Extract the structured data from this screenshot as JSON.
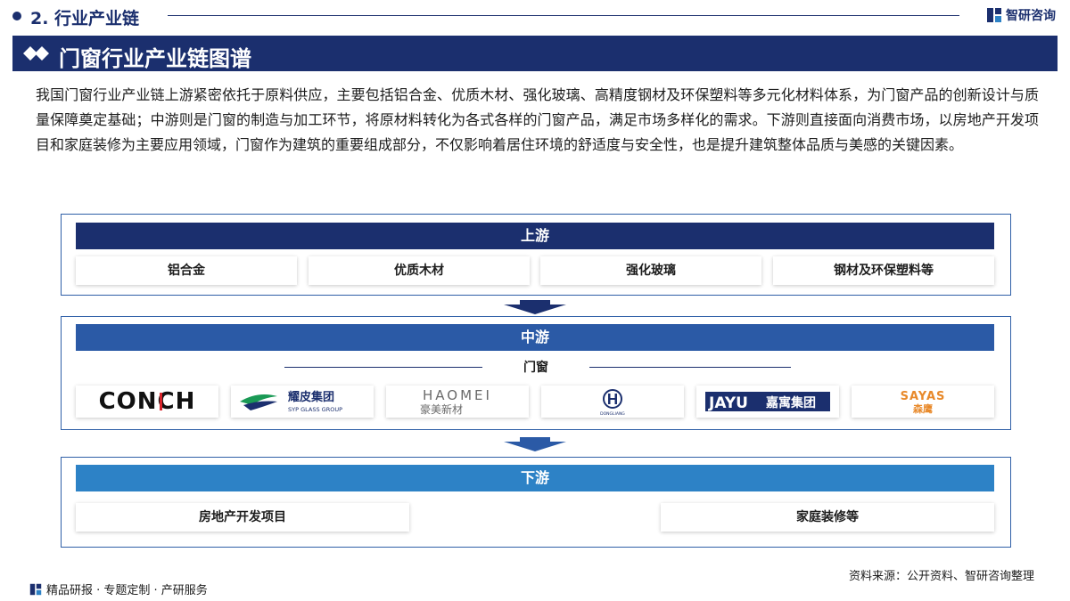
{
  "header": {
    "section_title": "2. 行业产业链",
    "brand_name": "智研咨询"
  },
  "banner": {
    "title": "门窗行业产业链图谱"
  },
  "intro": "我国门窗行业产业链上游紧密依托于原料供应，主要包括铝合金、优质木材、强化玻璃、高精度钢材及环保塑料等多元化材料体系，为门窗产品的创新设计与质量保障奠定基础；中游则是门窗的制造与加工环节，将原材料转化为各式各样的门窗产品，满足市场多样化的需求。下游则直接面向消费市场，以房地产开发项目和家庭装修为主要应用领域，门窗作为建筑的重要组成部分，不仅影响着居住环境的舒适度与安全性，也是提升建筑整体品质与美感的关键因素。",
  "upstream": {
    "title": "上游",
    "items": [
      "铝合金",
      "优质木材",
      "强化玻璃",
      "钢材及环保塑料等"
    ]
  },
  "midstream": {
    "title": "中游",
    "label": "门窗",
    "logos": [
      {
        "name": "conch",
        "text": "CONCH"
      },
      {
        "name": "syp",
        "text": "耀皮集团",
        "subtext": "SYP GLASS GROUP"
      },
      {
        "name": "haomei",
        "text": "HAOMEI",
        "subtext": "豪美新材"
      },
      {
        "name": "dongliang",
        "text": "DONGLIANG"
      },
      {
        "name": "jayu",
        "text": "JAYU",
        "subtext": "嘉寓集团"
      },
      {
        "name": "sayas",
        "text": "SAYAS",
        "subtext": "森鹰"
      }
    ]
  },
  "downstream": {
    "title": "下游",
    "items": [
      "房地产开发项目",
      "家庭装修等"
    ]
  },
  "footer": {
    "left": "精品研报 · 专题定制 · 产研服务",
    "source": "资料来源：公开资料、智研咨询整理"
  },
  "colors": {
    "navy": "#1b2f6e",
    "mid_blue": "#2b5aa6",
    "light_blue": "#2d82c6",
    "conch_red": "#d8232a",
    "syp_green": "#1a9a55",
    "sayas_orange": "#e8892a"
  }
}
